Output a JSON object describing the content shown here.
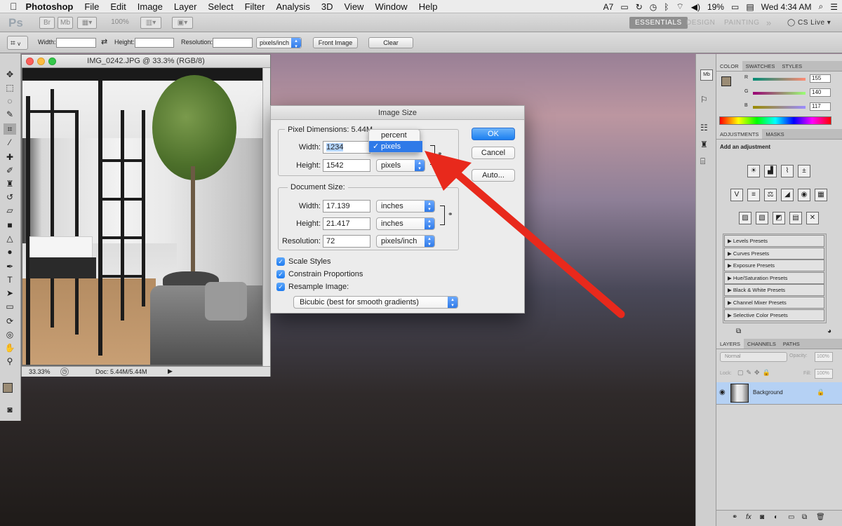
{
  "menubar": {
    "apple": "",
    "app": "Photoshop",
    "items": [
      "File",
      "Edit",
      "Image",
      "Layer",
      "Select",
      "Filter",
      "Analysis",
      "3D",
      "View",
      "Window",
      "Help"
    ],
    "battery": "19%",
    "clock": "Wed 4:34 AM",
    "status_extra": "7"
  },
  "appbar": {
    "logo": "Ps",
    "br": "Br",
    "mb": "Mb",
    "zoom": "100%",
    "workspaces": [
      "ESSENTIALS",
      "DESIGN",
      "PAINTING"
    ],
    "more": "»",
    "cslive": "CS Live"
  },
  "options": {
    "width_label": "Width:",
    "height_label": "Height:",
    "resolution_label": "Resolution:",
    "unit": "pixels/inch",
    "front_image": "Front Image",
    "clear": "Clear",
    "tool_mark": "v"
  },
  "document": {
    "title": "IMG_0242.JPG @ 33.3% (RGB/8)",
    "zoom": "33.33%",
    "doc_info": "Doc: 5.44M/5.44M"
  },
  "dialog": {
    "title": "Image Size",
    "pixel_dimensions": {
      "label": "Pixel Dimensions:",
      "size": "5.44M",
      "width_label": "Width:",
      "width": "1234",
      "height_label": "Height:",
      "height": "1542",
      "height_unit": "pixels"
    },
    "document_size": {
      "label": "Document Size:",
      "width_label": "Width:",
      "width": "17.139",
      "width_unit": "inches",
      "height_label": "Height:",
      "height": "21.417",
      "height_unit": "inches",
      "resolution_label": "Resolution:",
      "resolution": "72",
      "resolution_unit": "pixels/inch"
    },
    "checkboxes": {
      "scale_styles": "Scale Styles",
      "constrain": "Constrain Proportions",
      "resample": "Resample Image:"
    },
    "resample_method": "Bicubic (best for smooth gradients)",
    "buttons": {
      "ok": "OK",
      "cancel": "Cancel",
      "auto": "Auto..."
    },
    "unit_popup": {
      "options": [
        "percent",
        "pixels"
      ],
      "selected": "pixels",
      "check": "✓"
    }
  },
  "color_panel": {
    "tabs": [
      "COLOR",
      "SWATCHES",
      "STYLES"
    ],
    "r_label": "R",
    "g_label": "G",
    "b_label": "B",
    "r": "155",
    "g": "140",
    "b": "117"
  },
  "adjustments_panel": {
    "tabs": [
      "ADJUSTMENTS",
      "MASKS"
    ],
    "heading": "Add an adjustment",
    "presets": [
      "Levels Presets",
      "Curves Presets",
      "Exposure Presets",
      "Hue/Saturation Presets",
      "Black & White Presets",
      "Channel Mixer Presets",
      "Selective Color Presets"
    ]
  },
  "layers_panel": {
    "tabs": [
      "LAYERS",
      "CHANNELS",
      "PATHS"
    ],
    "blend_mode": "Normal",
    "opacity_label": "Opacity:",
    "opacity": "100%",
    "lock_label": "Lock:",
    "fill_label": "Fill:",
    "fill": "100%",
    "layer_name": "Background"
  },
  "colors": {
    "accent": "#2f7ae8",
    "arrow": "#e8291c",
    "foreground": "#9b8c75"
  }
}
